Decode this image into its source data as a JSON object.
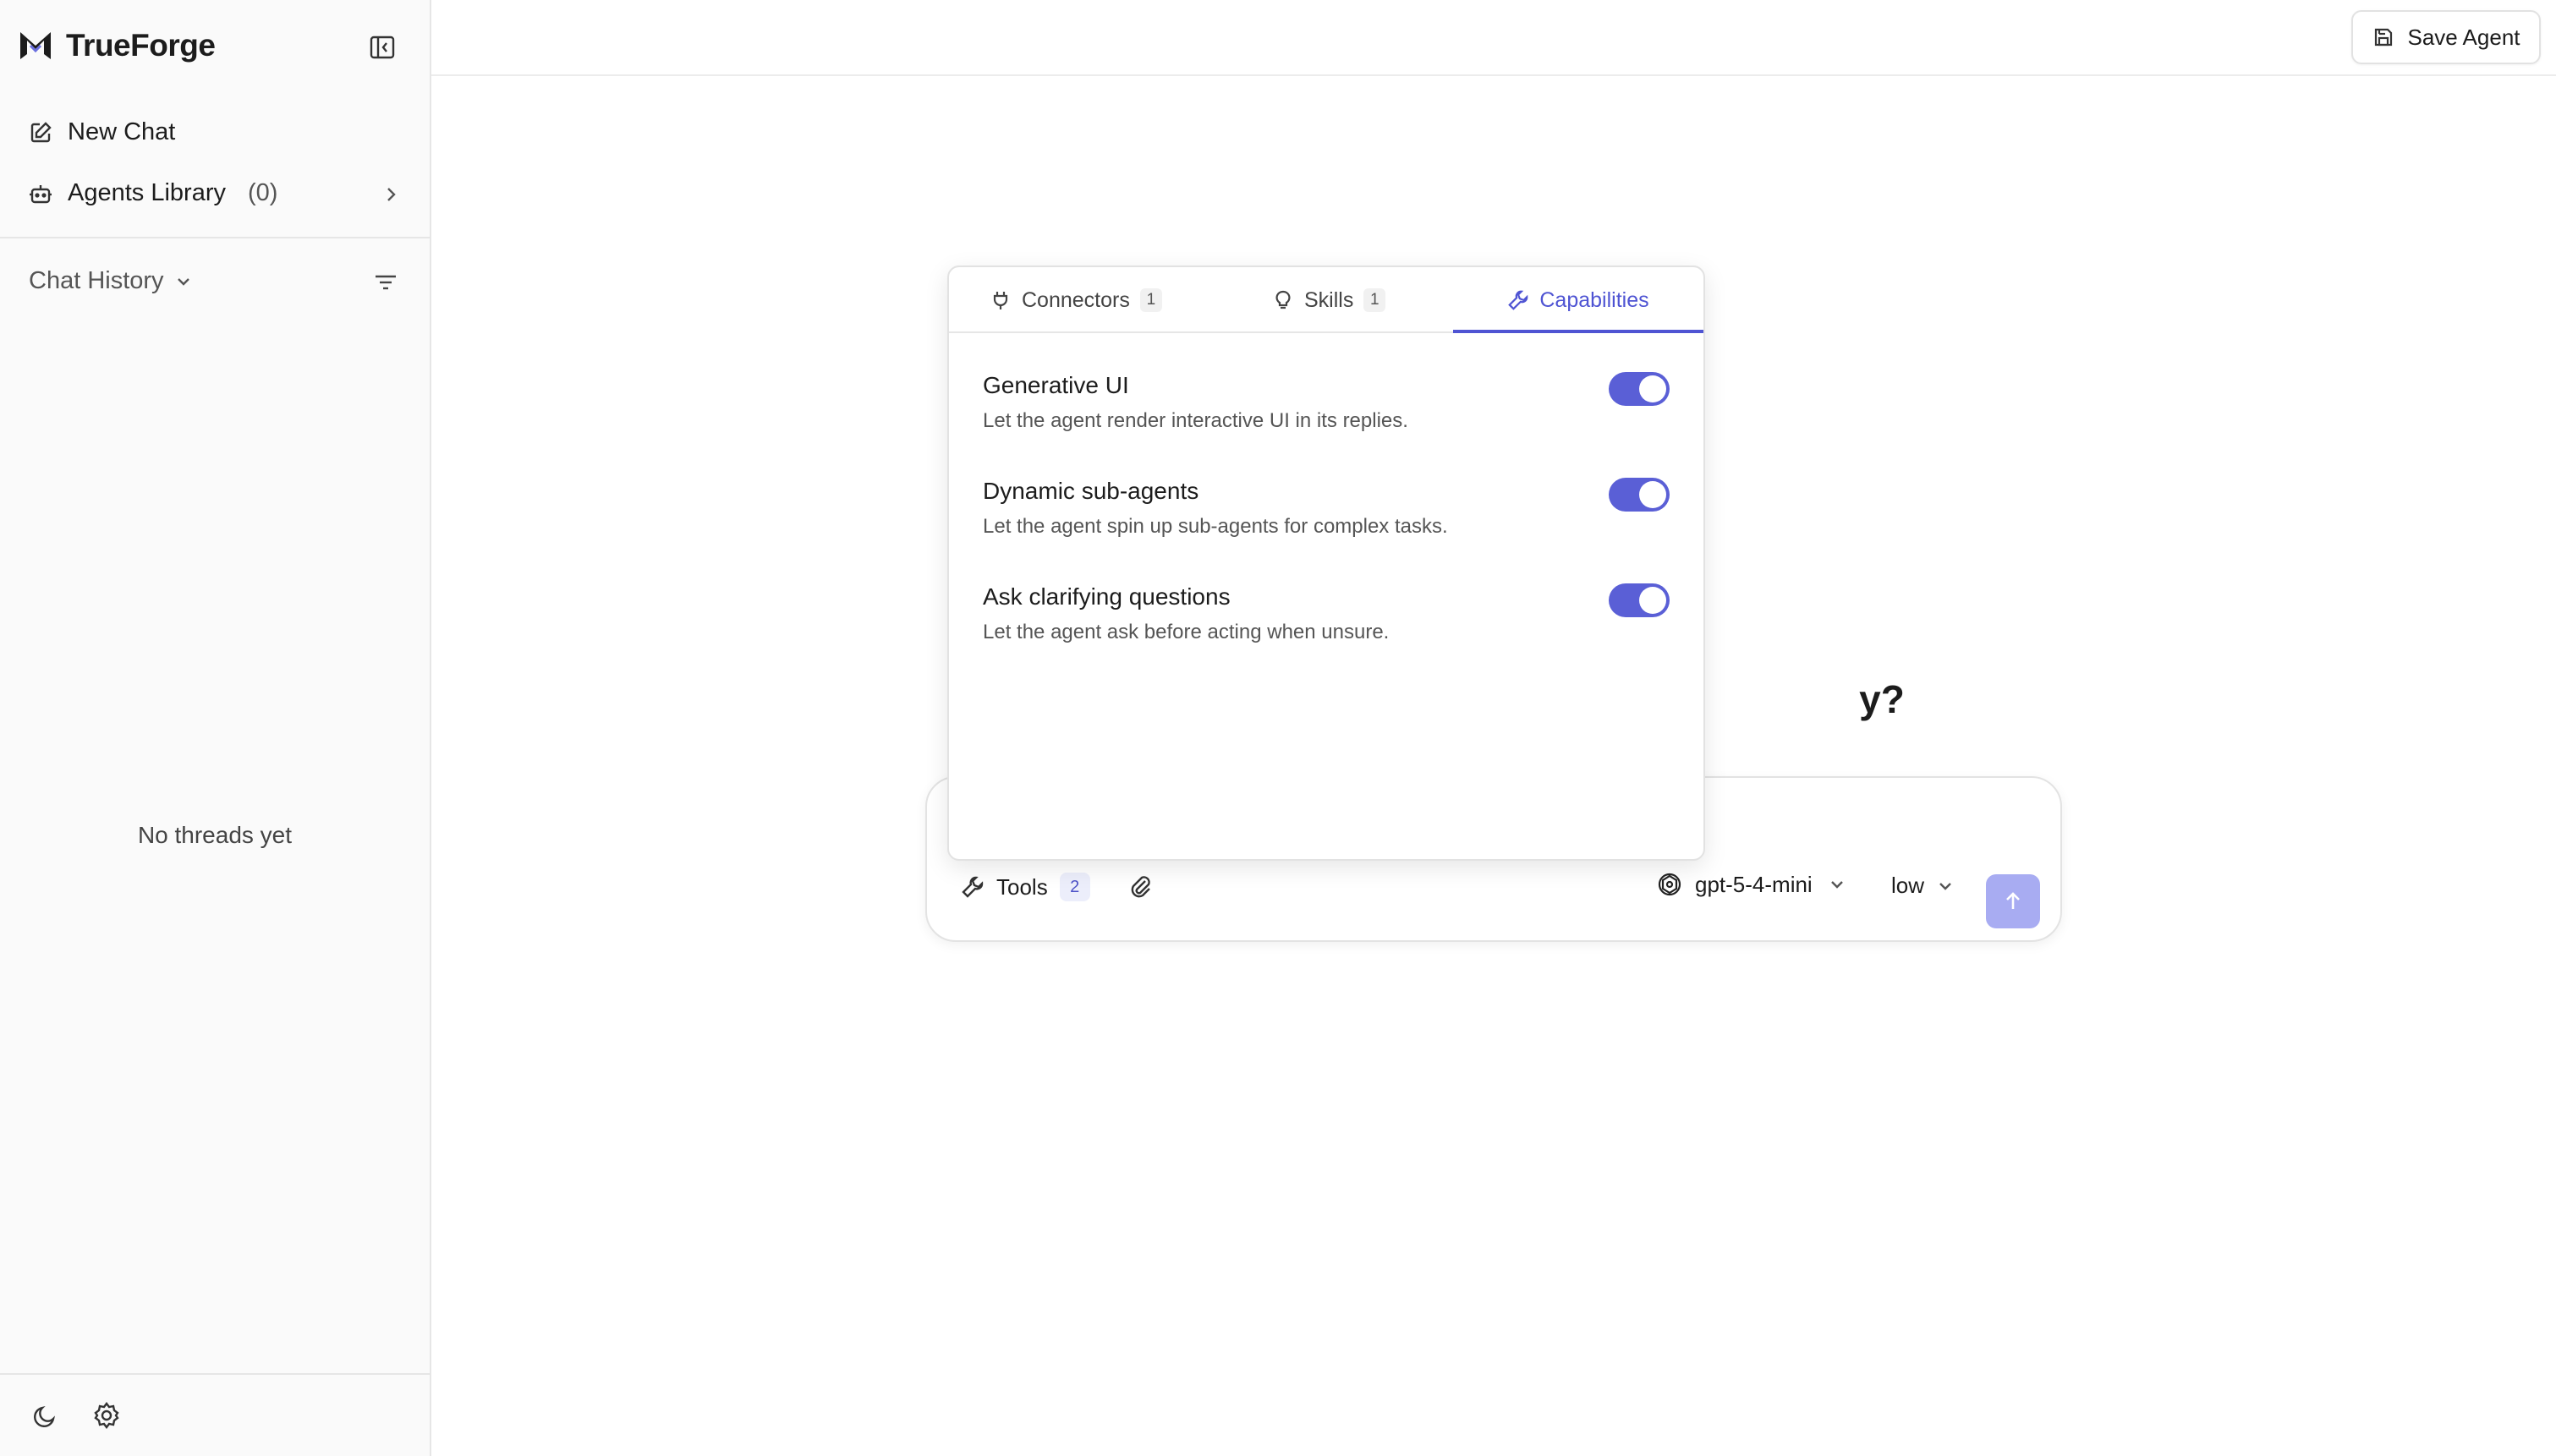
{
  "app": {
    "name": "TrueForge"
  },
  "sidebar": {
    "new_chat": "New Chat",
    "agents_library": "Agents Library",
    "agents_count": "(0)",
    "chat_history": "Chat History",
    "empty_state": "No threads yet"
  },
  "topbar": {
    "save_agent": "Save Agent"
  },
  "main": {
    "hero_partial": "y?"
  },
  "composer": {
    "tools_label": "Tools",
    "tools_count": "2",
    "model": "gpt-5-4-mini",
    "effort": "low"
  },
  "popover": {
    "tabs": [
      {
        "label": "Connectors",
        "count": "1"
      },
      {
        "label": "Skills",
        "count": "1"
      },
      {
        "label": "Capabilities"
      }
    ],
    "active_tab": "Capabilities",
    "capabilities": [
      {
        "title": "Generative UI",
        "description": "Let the agent render interactive UI in its replies.",
        "enabled": true
      },
      {
        "title": "Dynamic sub-agents",
        "description": "Let the agent spin up sub-agents for complex tasks.",
        "enabled": true
      },
      {
        "title": "Ask clarifying questions",
        "description": "Let the agent ask before acting when unsure.",
        "enabled": true
      }
    ]
  },
  "colors": {
    "accent": "#4f54d3",
    "toggle_on": "#5a5fd6",
    "send_disabled": "#a8acf2"
  }
}
